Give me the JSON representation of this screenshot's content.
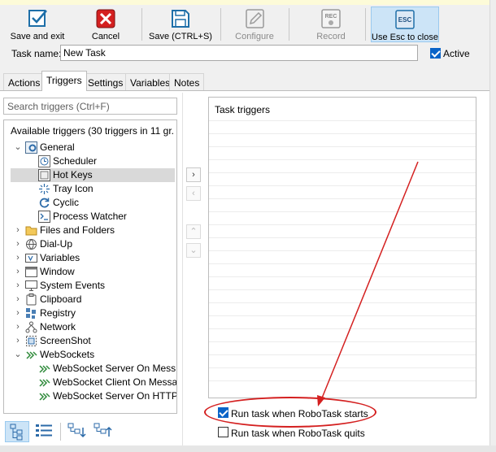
{
  "toolbar": {
    "save_exit": "Save and exit",
    "cancel": "Cancel",
    "save": "Save (CTRL+S)",
    "configure": "Configure",
    "record": "Record",
    "use_esc": "Use Esc to close",
    "rec_badge": "REC",
    "esc_badge": "ESC"
  },
  "task": {
    "name_label": "Task name:",
    "name_value": "New Task",
    "active_label": "Active",
    "active_checked": true
  },
  "tabs": [
    {
      "label": "Actions"
    },
    {
      "label": "Triggers",
      "selected": true
    },
    {
      "label": "Settings"
    },
    {
      "label": "Variables"
    },
    {
      "label": "Notes"
    }
  ],
  "search": {
    "placeholder": "Search triggers (Ctrl+F)"
  },
  "tree": {
    "header": "Available triggers (30 triggers in 11 gr...",
    "general": {
      "label": "General",
      "children": [
        "Scheduler",
        "Hot Keys",
        "Tray Icon",
        "Cyclic",
        "Process Watcher"
      ],
      "selected": "Hot Keys"
    },
    "groups": [
      "Files and Folders",
      "Dial-Up",
      "Variables",
      "Window",
      "System Events",
      "Clipboard",
      "Registry",
      "Network",
      "ScreenShot"
    ],
    "websockets": {
      "label": "WebSockets",
      "children": [
        "WebSocket Server On Mess...",
        "WebSocket Client On Message",
        "WebSocket Server On HTTP..."
      ]
    }
  },
  "right": {
    "title": "Task triggers",
    "run_on_start": "Run task when RoboTask starts",
    "run_on_start_checked": true,
    "run_on_quit": "Run task when RoboTask quits",
    "run_on_quit_checked": false
  },
  "colors": {
    "accent": "#0a64c8",
    "annotation": "#d42020",
    "active_button": "#cce4f7"
  }
}
